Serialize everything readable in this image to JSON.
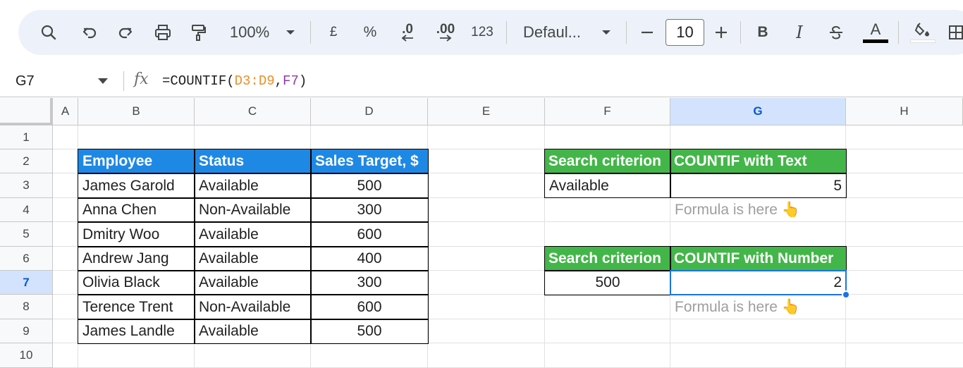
{
  "toolbar": {
    "zoom": "100%",
    "currency": "£",
    "percent": "%",
    "decrease_decimals": ".0",
    "increase_decimals": ".00",
    "number_format": "123",
    "font": "Defaul...",
    "font_size": "10",
    "bold": "B",
    "italic": "I",
    "text_color": "A",
    "text_color_hex": "#000000",
    "fill_color_hex": "#ffffff"
  },
  "formula_bar": {
    "name_box": "G7",
    "fx": "fx",
    "formula_prefix": "=COUNTIF(",
    "formula_ref1": "D3:D9",
    "formula_comma": ",",
    "formula_ref2": "F7",
    "formula_suffix": ")"
  },
  "columns": [
    "A",
    "B",
    "C",
    "D",
    "E",
    "F",
    "G",
    "H"
  ],
  "rows": [
    "1",
    "2",
    "3",
    "4",
    "5",
    "6",
    "7",
    "8",
    "9",
    "10"
  ],
  "selected": {
    "column": "G",
    "row": "7"
  },
  "employee_table": {
    "headers": [
      "Employee",
      "Status",
      "Sales Target, $"
    ],
    "rows": [
      [
        "James Garold",
        "Available",
        "500"
      ],
      [
        "Anna Chen",
        "Non-Available",
        "300"
      ],
      [
        "Dmitry Woo",
        "Available",
        "600"
      ],
      [
        "Andrew Jang",
        "Available",
        "400"
      ],
      [
        "Olivia Black",
        "Available",
        "300"
      ],
      [
        "Terence Trent",
        "Non-Available",
        "600"
      ],
      [
        "James Landle",
        "Available",
        "500"
      ]
    ]
  },
  "text_count": {
    "header_criterion": "Search criterion",
    "header_result": "COUNTIF with Text",
    "criterion": "Available",
    "result": "5",
    "note": "Formula is here 👆"
  },
  "number_count": {
    "header_criterion": "Search criterion",
    "header_result": "COUNTIF with Number",
    "criterion": "500",
    "result": "2",
    "note": "Formula is here 👆"
  },
  "colors": {
    "header_blue": "#1e88e5",
    "header_green": "#43b649",
    "selection": "#1a73e8",
    "ref_orange": "#e8902b",
    "ref_purple": "#8e3aa8"
  }
}
